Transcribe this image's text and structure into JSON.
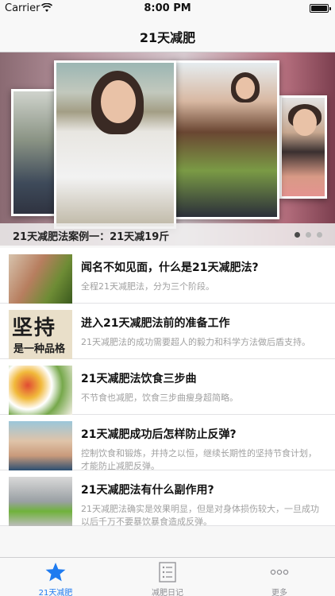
{
  "status_bar": {
    "carrier": "Carrier",
    "time": "8:00 PM"
  },
  "nav": {
    "title": "21天减肥"
  },
  "banner": {
    "caption": "21天减肥法案例一：21天减19斤",
    "page_count": 3,
    "active_page": 1
  },
  "articles": [
    {
      "title": "闻名不如见面，什么是21天减肥法?",
      "desc": "全程21天减肥法，分为三个阶段。",
      "thumbnail": "woman-with-vegetables-image"
    },
    {
      "title": "进入21天减肥法前的准备工作",
      "desc": "21天减肥法的成功需要超人的毅力和科学方法做后盾支持。",
      "thumbnail": "calligraphy-image",
      "thumbnail_text_big": "坚持",
      "thumbnail_text_small": "是一种品格"
    },
    {
      "title": "21天减肥法饮食三步曲",
      "desc": "不节食也减肥，饮食三步曲瘦身超简略。",
      "thumbnail": "food-plates-image"
    },
    {
      "title": "21天减肥成功后怎样防止反弹?",
      "desc": "控制饮食和锻炼，并持之以恒，继续长期性的坚持节食计划，才能防止减肥反弹。",
      "thumbnail": "waist-measure-image"
    },
    {
      "title": "21天减肥法有什么副作用?",
      "desc": "21天减肥法确实是效果明显，但是对身体损伤较大，一旦成功以后千万不要暴饮暴食造成反弹。",
      "thumbnail": "diet-plate-image"
    }
  ],
  "tab_bar": {
    "tabs": [
      {
        "label": "21天减肥",
        "icon": "star-icon",
        "selected": true
      },
      {
        "label": "减肥日记",
        "icon": "list-icon",
        "selected": false
      },
      {
        "label": "更多",
        "icon": "more-icon",
        "selected": false
      }
    ]
  },
  "colors": {
    "accent": "#1f7bf0",
    "tab_inactive": "#8e8e93",
    "desc_text": "#a0a0a0"
  }
}
